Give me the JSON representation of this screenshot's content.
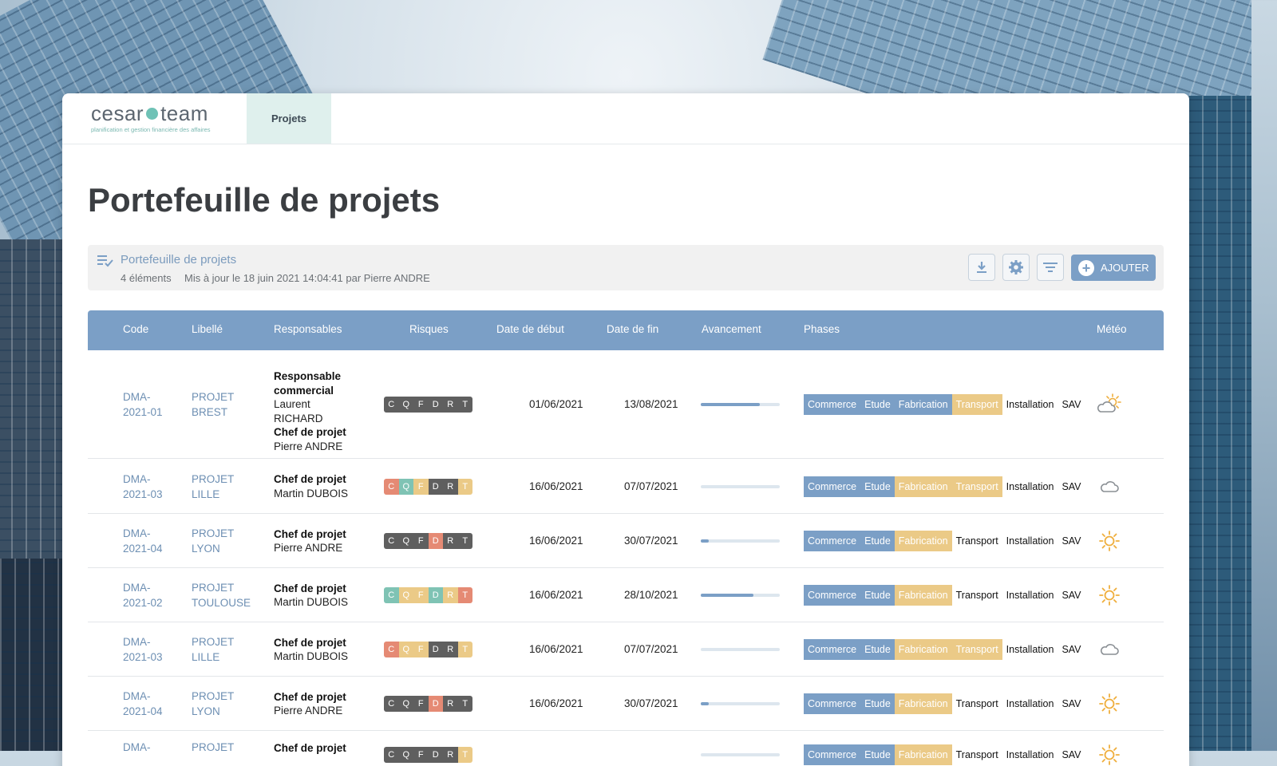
{
  "app": {
    "logo_word_left": "cesar",
    "logo_word_right": "team",
    "logo_tagline": "planification et gestion financière des affaires",
    "nav_tab": "Projets"
  },
  "page_title": "Portefeuille de projets",
  "toolbar": {
    "title": "Portefeuille de projets",
    "count": "4 éléments",
    "updated": "Mis à jour le 18 juin 2021 14:04:41 par Pierre ANDRE",
    "add_label": "AJOUTER"
  },
  "table": {
    "headers": {
      "code": "Code",
      "label": "Libellé",
      "resp": "Responsables",
      "risks": "Risques",
      "start": "Date de début",
      "end": "Date de fin",
      "progress": "Avancement",
      "phases": "Phases",
      "meteo": "Météo"
    },
    "risk_letters": [
      "C",
      "Q",
      "F",
      "D",
      "R",
      "T"
    ],
    "phase_names": [
      "Commerce",
      "Etude",
      "Fabrication",
      "Transport",
      "Installation",
      "SAV"
    ],
    "colors": {
      "risk_grey": "#5f5f5f",
      "risk_red": "#e58a74",
      "risk_green": "#7fc3b4",
      "risk_yellow": "#ebca87",
      "phase_blue": "#7b9fc6",
      "phase_yellow": "#ebca87"
    },
    "rows": [
      {
        "code_l1": "DMA-",
        "code_l2": "2021-01",
        "label_l1": "PROJET",
        "label_l2": "BREST",
        "resp": [
          {
            "role": "Responsable commercial",
            "name": "Laurent RICHARD"
          },
          {
            "role": "Chef de projet",
            "name": "Pierre ANDRE"
          }
        ],
        "risks": [
          "grey",
          "grey",
          "grey",
          "grey",
          "grey",
          "grey"
        ],
        "start": "01/06/2021",
        "end": "13/08/2021",
        "progress": 0.75,
        "phases": [
          "blue",
          "blue",
          "blue",
          "yellow",
          "none",
          "none"
        ],
        "meteo": "cloud-sun-icon"
      },
      {
        "code_l1": "DMA-",
        "code_l2": "2021-03",
        "label_l1": "PROJET",
        "label_l2": "LILLE",
        "resp": [
          {
            "role": "Chef de projet",
            "name": "Martin DUBOIS"
          }
        ],
        "risks": [
          "red",
          "green",
          "yellow",
          "grey",
          "grey",
          "yellow"
        ],
        "start": "16/06/2021",
        "end": "07/07/2021",
        "progress": 0.0,
        "phases": [
          "blue",
          "blue",
          "yellow",
          "yellow",
          "none",
          "none"
        ],
        "meteo": "cloud-icon"
      },
      {
        "code_l1": "DMA-",
        "code_l2": "2021-04",
        "label_l1": "PROJET",
        "label_l2": "LYON",
        "resp": [
          {
            "role": "Chef de projet",
            "name": "Pierre ANDRE"
          }
        ],
        "risks": [
          "grey",
          "grey",
          "grey",
          "red",
          "grey",
          "grey"
        ],
        "start": "16/06/2021",
        "end": "30/07/2021",
        "progress": 0.1,
        "phases": [
          "blue",
          "blue",
          "yellow",
          "none",
          "none",
          "none"
        ],
        "meteo": "sun-icon"
      },
      {
        "code_l1": "DMA-",
        "code_l2": "2021-02",
        "label_l1": "PROJET",
        "label_l2": "TOULOUSE",
        "resp": [
          {
            "role": "Chef de projet",
            "name": "Martin DUBOIS"
          }
        ],
        "risks": [
          "green",
          "yellow",
          "yellow",
          "green",
          "yellow",
          "red"
        ],
        "start": "16/06/2021",
        "end": "28/10/2021",
        "progress": 0.67,
        "phases": [
          "blue",
          "blue",
          "yellow",
          "none",
          "none",
          "none"
        ],
        "meteo": "sun-icon"
      },
      {
        "code_l1": "DMA-",
        "code_l2": "2021-03",
        "label_l1": "PROJET",
        "label_l2": "LILLE",
        "resp": [
          {
            "role": "Chef de projet",
            "name": "Martin DUBOIS"
          }
        ],
        "risks": [
          "red",
          "yellow",
          "yellow",
          "grey",
          "grey",
          "yellow"
        ],
        "start": "16/06/2021",
        "end": "07/07/2021",
        "progress": 0.0,
        "phases": [
          "blue",
          "blue",
          "yellow",
          "yellow",
          "none",
          "none"
        ],
        "meteo": "cloud-icon"
      },
      {
        "code_l1": "DMA-",
        "code_l2": "2021-04",
        "label_l1": "PROJET",
        "label_l2": "LYON",
        "resp": [
          {
            "role": "Chef de projet",
            "name": "Pierre ANDRE"
          }
        ],
        "risks": [
          "grey",
          "grey",
          "grey",
          "red",
          "grey",
          "grey"
        ],
        "start": "16/06/2021",
        "end": "30/07/2021",
        "progress": 0.1,
        "phases": [
          "blue",
          "blue",
          "yellow",
          "none",
          "none",
          "none"
        ],
        "meteo": "sun-icon"
      },
      {
        "code_l1": "DMA-",
        "code_l2": "",
        "label_l1": "PROJET",
        "label_l2": "",
        "resp": [
          {
            "role": "Chef de projet",
            "name": ""
          }
        ],
        "risks": [
          "grey",
          "grey",
          "grey",
          "grey",
          "grey",
          "yellow"
        ],
        "start": "",
        "end": "",
        "progress": 0.0,
        "phases": [
          "blue",
          "blue",
          "yellow",
          "none",
          "none",
          "none"
        ],
        "meteo": "sun-icon"
      }
    ]
  }
}
